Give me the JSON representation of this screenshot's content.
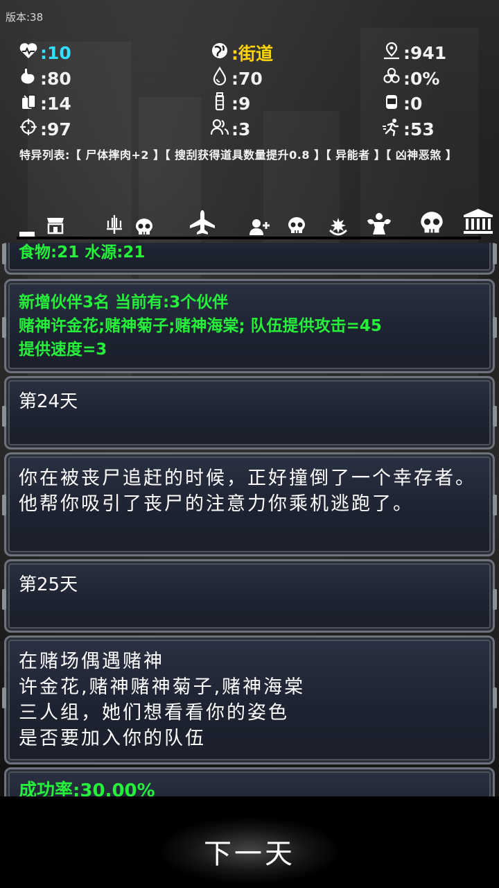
{
  "version": "版本:38",
  "stats": {
    "health": ":10",
    "location": ":街道",
    "distance": ":941",
    "hunger": ":80",
    "water": ":70",
    "infection": ":0%",
    "food_items": ":14",
    "bottles": ":9",
    "cans": ":0",
    "accuracy": ":97",
    "companions": ":3",
    "speed": ":53"
  },
  "traits": "特异列表:【 尸体摔肉+2 】【 搜刮获得道具数量提升0.8 】【 异能者 】【 凶神恶煞 】",
  "colors": {
    "health": "#33e0ff",
    "location": "#ffd400",
    "stat_text": "#f2f2f2",
    "event_green": "#25f03a"
  },
  "toolbar": {
    "icons": [
      "bar-icon",
      "shop-icon",
      "sword-icon",
      "skull-icon",
      "plane-icon",
      "add-friend-icon",
      "skull-icon",
      "prayer-icon",
      "strength-icon",
      "skull-icon",
      "bank-icon"
    ]
  },
  "feed": {
    "card0_text": "食物:21  水源:21",
    "card1_text": "新增伙伴3名  当前有:3个伙伴\n赌神许金花;赌神菊子;赌神海棠; 队伍提供攻击=45\n提供速度=3",
    "card2_text": "第24天",
    "card3_text": "你在被丧尸追赶的时候，正好撞倒了一个幸存者。他帮你吸引了丧尸的注意力你乘机逃跑了。",
    "card4_text": "第25天",
    "card5_text": "在赌场偶遇赌神\n许金花,赌神赌神菊子,赌神海棠\n三人组，她们想看看你的姿色\n是否要加入你的队伍",
    "card6_text": "成功率:30.00%"
  },
  "next_button": "下一天"
}
